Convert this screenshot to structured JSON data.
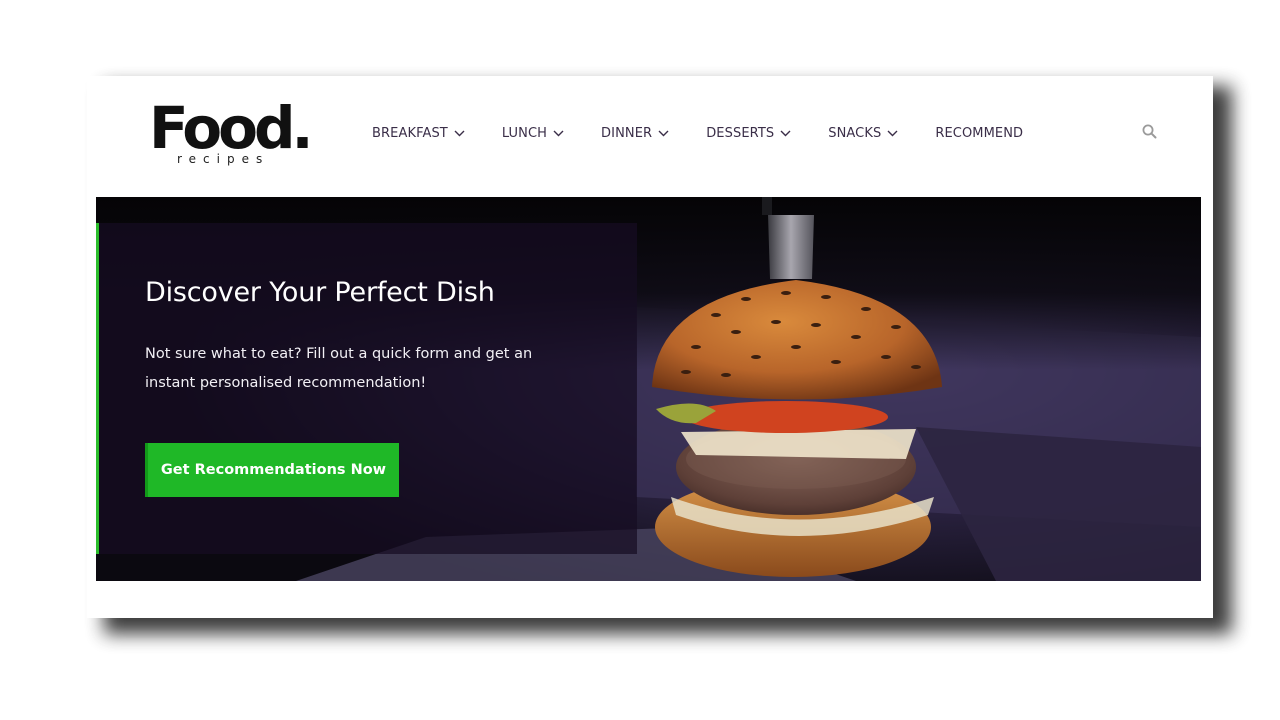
{
  "brand": {
    "name": "Food.",
    "tagline": "recipes"
  },
  "nav": {
    "items": [
      {
        "label": "BREAKFAST",
        "dropdown": true
      },
      {
        "label": "LUNCH",
        "dropdown": true
      },
      {
        "label": "DINNER",
        "dropdown": true
      },
      {
        "label": "DESSERTS",
        "dropdown": true
      },
      {
        "label": "SNACKS",
        "dropdown": true
      },
      {
        "label": "RECOMMEND",
        "dropdown": false
      }
    ],
    "search_icon": "search-icon"
  },
  "hero": {
    "title": "Discover Your Perfect Dish",
    "text": "Not sure what to eat? Fill out a quick form and get an instant personalised recommendation!",
    "cta_label": "Get Recommendations Now",
    "image": "burger-photo"
  },
  "colors": {
    "accent": "#1fb827",
    "nav_text": "#3a2e48",
    "hero_overlay": "#160c22"
  }
}
